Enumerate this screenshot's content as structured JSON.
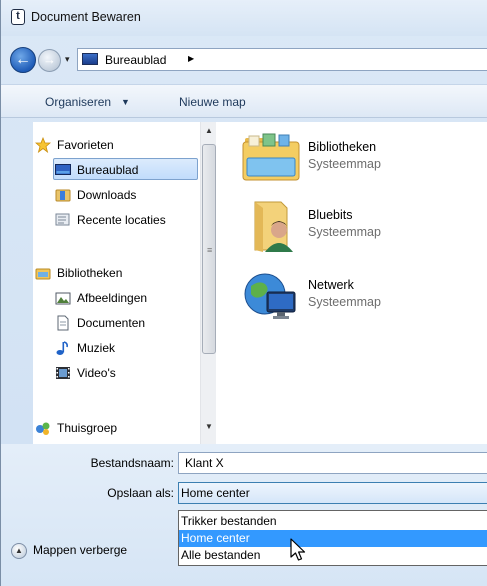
{
  "window": {
    "title": "Document Bewaren",
    "title_icon_glyph": "t"
  },
  "address": {
    "location": "Bureaublad",
    "back_glyph": "←",
    "forward_glyph": "→",
    "nav_dropdown_glyph": "▾",
    "crumb_arrow_glyph": "▶"
  },
  "toolbar": {
    "organise_label": "Organiseren",
    "organise_caret": "▼",
    "new_folder_label": "Nieuwe map"
  },
  "sidebar": {
    "items": [
      {
        "label": "Favorieten",
        "icon": "star-icon"
      },
      {
        "label": "Bureaublad",
        "icon": "desktop-icon",
        "selected": true
      },
      {
        "label": "Downloads",
        "icon": "downloads-folder-icon"
      },
      {
        "label": "Recente locaties",
        "icon": "recent-places-icon"
      },
      {
        "label": "Bibliotheken",
        "icon": "libraries-icon"
      },
      {
        "label": "Afbeeldingen",
        "icon": "pictures-icon"
      },
      {
        "label": "Documenten",
        "icon": "documents-icon"
      },
      {
        "label": "Muziek",
        "icon": "music-icon"
      },
      {
        "label": "Video's",
        "icon": "video-icon"
      },
      {
        "label": "Thuisgroep",
        "icon": "homegroup-icon"
      }
    ],
    "scroll_up_glyph": "▲",
    "scroll_down_glyph": "▼",
    "grip_glyph": "≡"
  },
  "content": {
    "items": [
      {
        "name": "Bibliotheken",
        "type": "Systeemmap",
        "icon": "libraries-folder-icon"
      },
      {
        "name": "Bluebits",
        "type": "Systeemmap",
        "icon": "user-folder-icon"
      },
      {
        "name": "Netwerk",
        "type": "Systeemmap",
        "icon": "network-icon"
      }
    ]
  },
  "form": {
    "filename_label": "Bestandsnaam:",
    "filename_value": "Klant X",
    "savetype_label": "Opslaan als:",
    "savetype_value": "Home center",
    "savetype_options": [
      {
        "label": "Trikker bestanden",
        "selected": false
      },
      {
        "label": "Home center",
        "selected": true
      },
      {
        "label": "Alle bestanden",
        "selected": false
      }
    ]
  },
  "footer": {
    "hide_folders_label": "Mappen verberge",
    "toggle_glyph": "▲"
  },
  "colors": {
    "selection_blue": "#3399ff",
    "chrome_blue": "#dbe8f6"
  }
}
